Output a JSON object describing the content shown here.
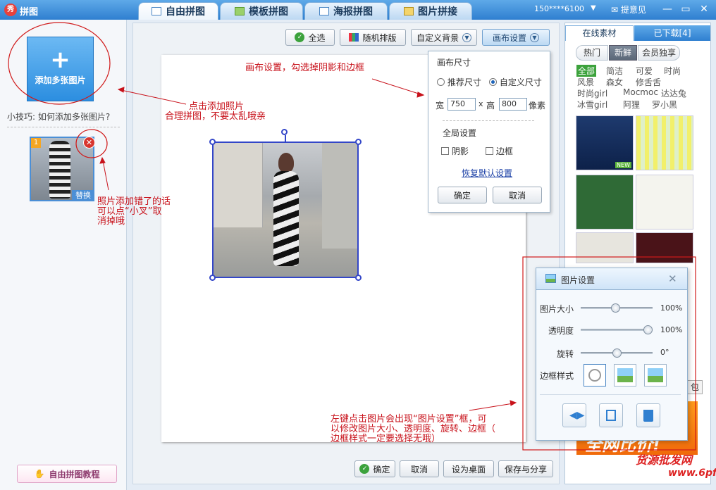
{
  "app": {
    "title": "拼图",
    "logo": "秀"
  },
  "tabs": [
    {
      "label": "自由拼图",
      "active": true
    },
    {
      "label": "模板拼图",
      "active": false
    },
    {
      "label": "海报拼图",
      "active": false
    },
    {
      "label": "图片拼接",
      "active": false
    }
  ],
  "header": {
    "username": "150****6100",
    "feedback": "提意见"
  },
  "left": {
    "add_button_label": "添加多张图片",
    "add_icon": "+",
    "tip": "小技巧: 如何添加多张图片?",
    "thumb_index": "1",
    "thumb_replace": "替换",
    "tutorial_button": "自由拼图教程"
  },
  "toolbar": {
    "select_all": "全选",
    "random_layout": "随机排版",
    "custom_background": "自定义背景",
    "canvas_settings": "画布设置"
  },
  "canvas_settings": {
    "section_size": "画布尺寸",
    "recommended": "推荐尺寸",
    "custom": "自定义尺寸",
    "selected": "custom",
    "width_label": "宽",
    "width_value": "750",
    "x": "x",
    "height_label": "高",
    "height_value": "800",
    "unit": "像素",
    "section_global": "全局设置",
    "shadow": "阴影",
    "border": "边框",
    "restore": "恢复默认设置",
    "ok": "确定",
    "cancel": "取消"
  },
  "bottom_bar": {
    "ok": "确定",
    "cancel": "取消",
    "set_desktop": "设为桌面",
    "save_share": "保存与分享"
  },
  "right": {
    "tab_online": "在线素材",
    "tab_downloaded": "已下载[4]",
    "filters": [
      "热门",
      "新鲜",
      "会员独享"
    ],
    "active_filter": "新鲜",
    "categories_row1": [
      "全部",
      "简洁",
      "可爱",
      "时尚"
    ],
    "categories_row2": [
      "风景",
      "森女",
      "修舌舌"
    ],
    "categories_row3": [
      "时尚girl",
      "Mocmoc",
      "达达兔"
    ],
    "categories_row4": [
      "冰雪girl",
      "阿狸",
      "罗小黑"
    ],
    "new_badge": "NEW",
    "partial_btn": "包"
  },
  "image_settings": {
    "title": "图片设置",
    "size_label": "图片大小",
    "size_value": "100%",
    "opacity_label": "透明度",
    "opacity_value": "100%",
    "rotate_label": "旋转",
    "rotate_value": "0°",
    "border_label": "边框样式",
    "size_fraction": 0.48,
    "opacity_fraction": 1.0,
    "rotate_fraction": 0.5
  },
  "annotations": {
    "canvas_note": "画布设置，勾选掉阴影和边框",
    "add_note_1": "点击添加照片",
    "add_note_2": "合理拼图，不要太乱哦亲",
    "delete_note_1": "照片添加错了的话",
    "delete_note_2": "可以点“小叉”取",
    "delete_note_3": "消掉哦",
    "dialog_note_1": "左键点击图片会出现“图片设置”框，可",
    "dialog_note_2": "以修改图片大小、透明度、旋转、边框（",
    "dialog_note_3": "边框样式一定要选择无哦）"
  },
  "ad": {
    "text": "全网比价!"
  },
  "watermark": {
    "line1": "货源批发网",
    "line2": "www.6pf.cn"
  },
  "colors": {
    "accent": "#2f7fd0",
    "annotation": "#c8121b"
  }
}
